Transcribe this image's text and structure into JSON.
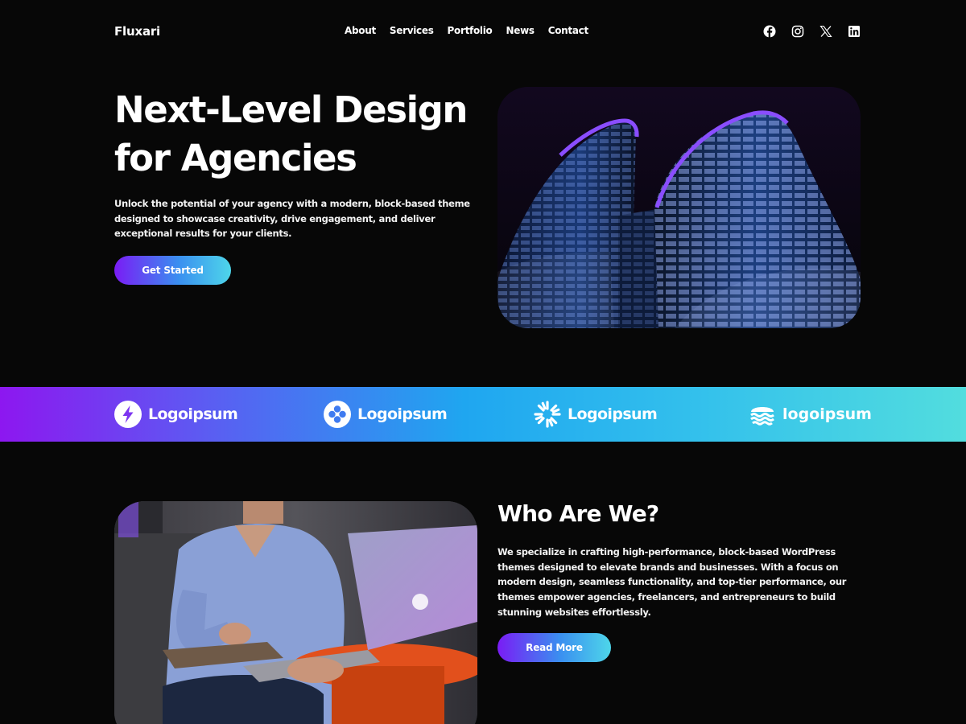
{
  "header": {
    "brand": "Fluxari",
    "nav": [
      "About",
      "Services",
      "Portfolio",
      "News",
      "Contact"
    ],
    "social_icons": [
      "facebook-icon",
      "instagram-icon",
      "x-icon",
      "linkedin-icon"
    ]
  },
  "hero": {
    "title_line1": "Next-Level Design",
    "title_line2": "for Agencies",
    "description": "Unlock the potential of your agency with a modern, block-based theme designed to showcase creativity, drive engagement, and deliver exceptional results for your clients.",
    "cta_label": "Get Started",
    "image": "night-skyscraper-photo"
  },
  "logos": [
    {
      "icon": "lightning-logo-icon",
      "label": "Logoipsum"
    },
    {
      "icon": "flower-logo-icon",
      "label": "Logoipsum"
    },
    {
      "icon": "sunburst-logo-icon",
      "label": "Logoipsum"
    },
    {
      "icon": "waves-logo-icon",
      "label": "logoipsum"
    }
  ],
  "about": {
    "title": "Who Are We?",
    "description": "We specialize in crafting high-performance, block-based WordPress themes designed to elevate brands and businesses. With a focus on modern design, seamless functionality, and top-tier performance, our themes empower agencies, freelancers, and entrepreneurs to build stunning websites effortlessly.",
    "cta_label": "Read More",
    "image": "man-with-laptop-photo"
  },
  "colors": {
    "background": "#070707",
    "text": "#ffffff",
    "gradient_start": "#7a1cf5",
    "gradient_end": "#4ed6ea"
  }
}
